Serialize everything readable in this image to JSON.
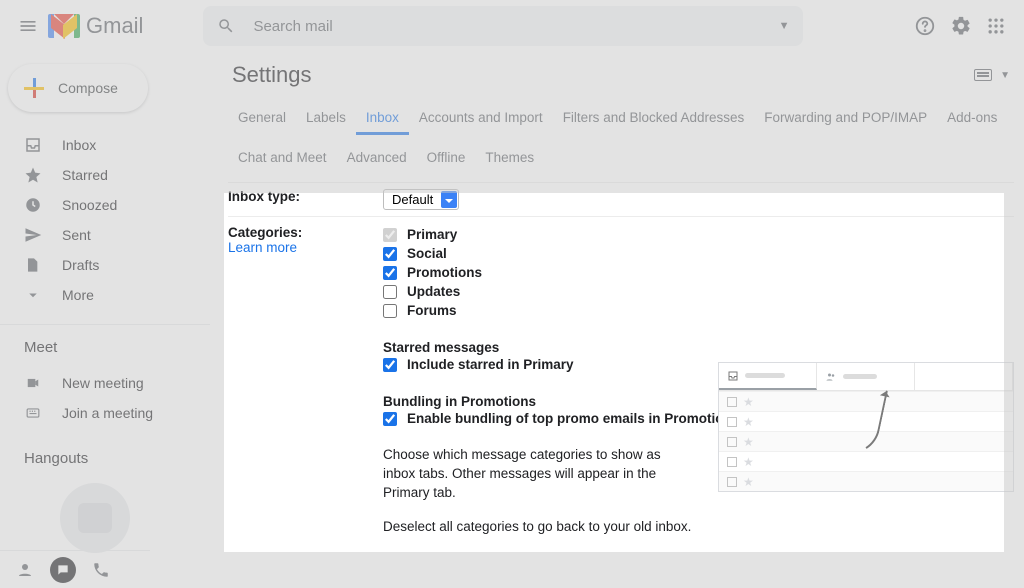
{
  "header": {
    "product": "Gmail",
    "search_placeholder": "Search mail"
  },
  "compose_label": "Compose",
  "nav": {
    "items": [
      {
        "label": "Inbox",
        "icon": "inbox"
      },
      {
        "label": "Starred",
        "icon": "star"
      },
      {
        "label": "Snoozed",
        "icon": "clock"
      },
      {
        "label": "Sent",
        "icon": "send"
      },
      {
        "label": "Drafts",
        "icon": "file"
      },
      {
        "label": "More",
        "icon": "expand"
      }
    ]
  },
  "meet": {
    "title": "Meet",
    "new_meeting": "New meeting",
    "join_meeting": "Join a meeting"
  },
  "hangouts": {
    "title": "Hangouts"
  },
  "settings": {
    "title": "Settings",
    "tabs": [
      "General",
      "Labels",
      "Inbox",
      "Accounts and Import",
      "Filters and Blocked Addresses",
      "Forwarding and POP/IMAP",
      "Add-ons",
      "Chat and Meet",
      "Advanced",
      "Offline",
      "Themes"
    ],
    "active_tab": "Inbox",
    "inbox_type": {
      "label": "Inbox type:",
      "value": "Default"
    },
    "categories": {
      "label": "Categories:",
      "learn_more": "Learn more",
      "options": [
        {
          "label": "Primary",
          "checked": true,
          "locked": true
        },
        {
          "label": "Social",
          "checked": true
        },
        {
          "label": "Promotions",
          "checked": true
        },
        {
          "label": "Updates",
          "checked": false
        },
        {
          "label": "Forums",
          "checked": false
        }
      ],
      "starred_hdr": "Starred messages",
      "starred_opt": "Include starred in Primary",
      "bundling_hdr": "Bundling in Promotions",
      "bundling_opt": "Enable bundling of top promo emails in Promotions",
      "desc1": "Choose which message categories to show as inbox tabs. Other messages will appear in the Primary tab.",
      "desc2": "Deselect all categories to go back to your old inbox."
    }
  }
}
